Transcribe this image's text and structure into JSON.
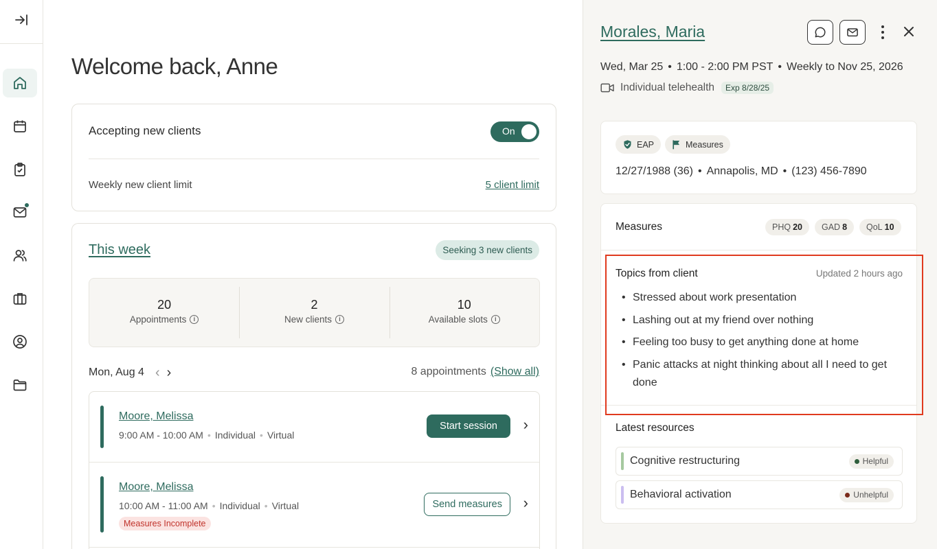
{
  "nav": {
    "items": [
      {
        "name": "home",
        "icon": "home-icon",
        "active": true
      },
      {
        "name": "calendar",
        "icon": "calendar-icon"
      },
      {
        "name": "tasks",
        "icon": "clipboard-check-icon"
      },
      {
        "name": "messages",
        "icon": "mail-icon",
        "unread": true
      },
      {
        "name": "clients",
        "icon": "users-icon"
      },
      {
        "name": "business",
        "icon": "briefcase-icon"
      },
      {
        "name": "profile",
        "icon": "user-circle-icon"
      },
      {
        "name": "files",
        "icon": "folder-icon"
      }
    ],
    "collapse_icon": "collapse-sidebar-icon"
  },
  "main": {
    "welcome": "Welcome back, Anne",
    "accepting": {
      "title": "Accepting new clients",
      "toggle_label": "On",
      "limit_label": "Weekly new client limit",
      "limit_link": "5 client limit"
    },
    "week": {
      "title": "This week",
      "seeking_badge": "Seeking 3 new clients",
      "stats": [
        {
          "value": "20",
          "label": "Appointments"
        },
        {
          "value": "2",
          "label": "New clients"
        },
        {
          "value": "10",
          "label": "Available slots"
        }
      ],
      "date": "Mon, Aug 4",
      "appointments_count": "8 appointments",
      "show_all": "(Show all)",
      "appointments": [
        {
          "name": "Moore, Melissa",
          "time": "9:00 AM - 10:00 AM",
          "type": "Individual",
          "mode": "Virtual",
          "action": "Start session"
        },
        {
          "name": "Moore, Melissa",
          "time": "10:00 AM - 11:00 AM",
          "type": "Individual",
          "mode": "Virtual",
          "badge": "Measures Incomplete",
          "action": "Send measures"
        }
      ]
    }
  },
  "panel": {
    "client_name": "Morales, Maria",
    "session_date": "Wed, Mar 25",
    "session_time": "1:00 - 2:00 PM PST",
    "session_recurrence": "Weekly to Nov 25, 2026",
    "session_type": "Individual telehealth",
    "session_exp": "Exp 8/28/25",
    "chips": [
      "EAP",
      "Measures"
    ],
    "dob": "12/27/1988 (36)",
    "location": "Annapolis, MD",
    "phone": "(123) 456-7890",
    "measures": {
      "title": "Measures",
      "scores": [
        {
          "label": "PHQ",
          "value": "20"
        },
        {
          "label": "GAD",
          "value": "8"
        },
        {
          "label": "QoL",
          "value": "10"
        }
      ]
    },
    "topics": {
      "title": "Topics from client",
      "updated": "Updated 2 hours ago",
      "items": [
        "Stressed about work presentation",
        "Lashing out at my friend over nothing",
        "Feeling too busy to get anything done at home",
        "Panic attacks at night thinking about all I need to get done"
      ]
    },
    "resources": {
      "title": "Latest resources",
      "items": [
        {
          "label": "Cognitive restructuring",
          "status": "Helpful",
          "bar_color": "#a6c9a0",
          "dot_color": "#2f5e3c"
        },
        {
          "label": "Behavioral activation",
          "status": "Unhelpful",
          "bar_color": "#cbbef0",
          "dot_color": "#7a2a1a"
        }
      ]
    }
  },
  "colors": {
    "accent": "#2e6b5e",
    "highlight": "#e03a1e",
    "incomplete": "#c0332b"
  }
}
